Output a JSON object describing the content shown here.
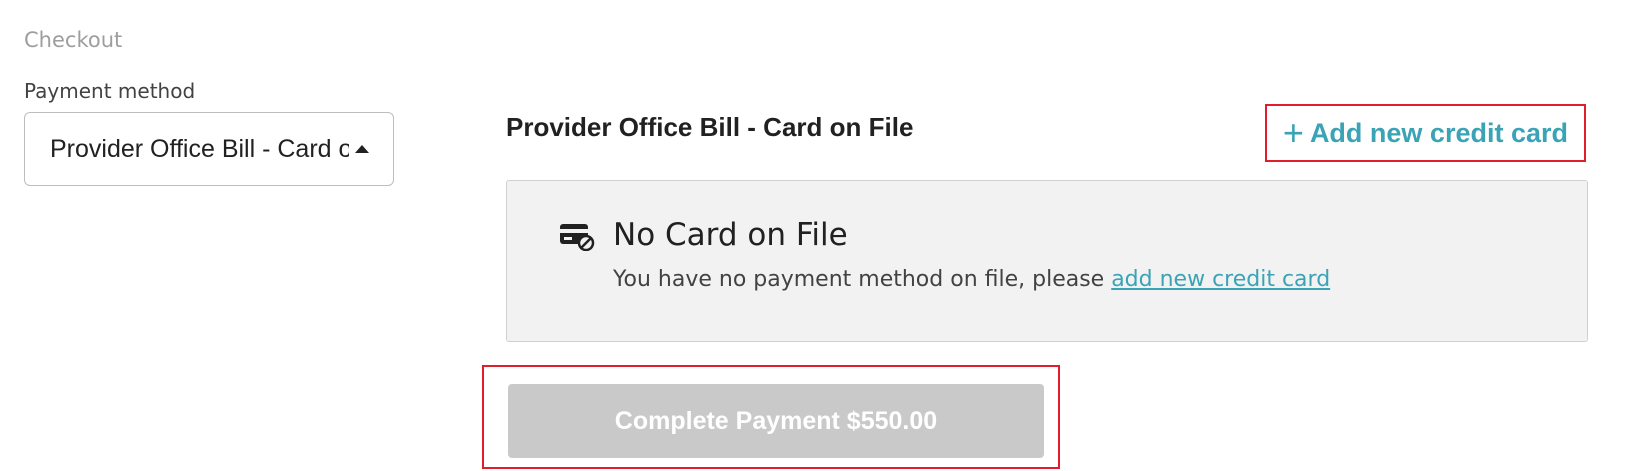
{
  "breadcrumb": "Checkout",
  "payment_method": {
    "label": "Payment method",
    "selected": "Provider Office Bill - Card on File"
  },
  "section": {
    "title": "Provider Office Bill - Card on File",
    "add_card_label": "Add new credit card",
    "add_card_icon": "plus-icon"
  },
  "card_box": {
    "icon": "card-off-icon",
    "title": "No Card on File",
    "message": "You have no payment method on file, please ",
    "link_text": "add new credit card"
  },
  "actions": {
    "complete_payment_label": "Complete Payment $550.00",
    "complete_payment_disabled": true
  },
  "colors": {
    "accent": "#3aa3b6",
    "disabled_button": "#c9c9c9",
    "card_box_bg": "#f2f2f2",
    "highlight_border": "#e11d2b"
  }
}
